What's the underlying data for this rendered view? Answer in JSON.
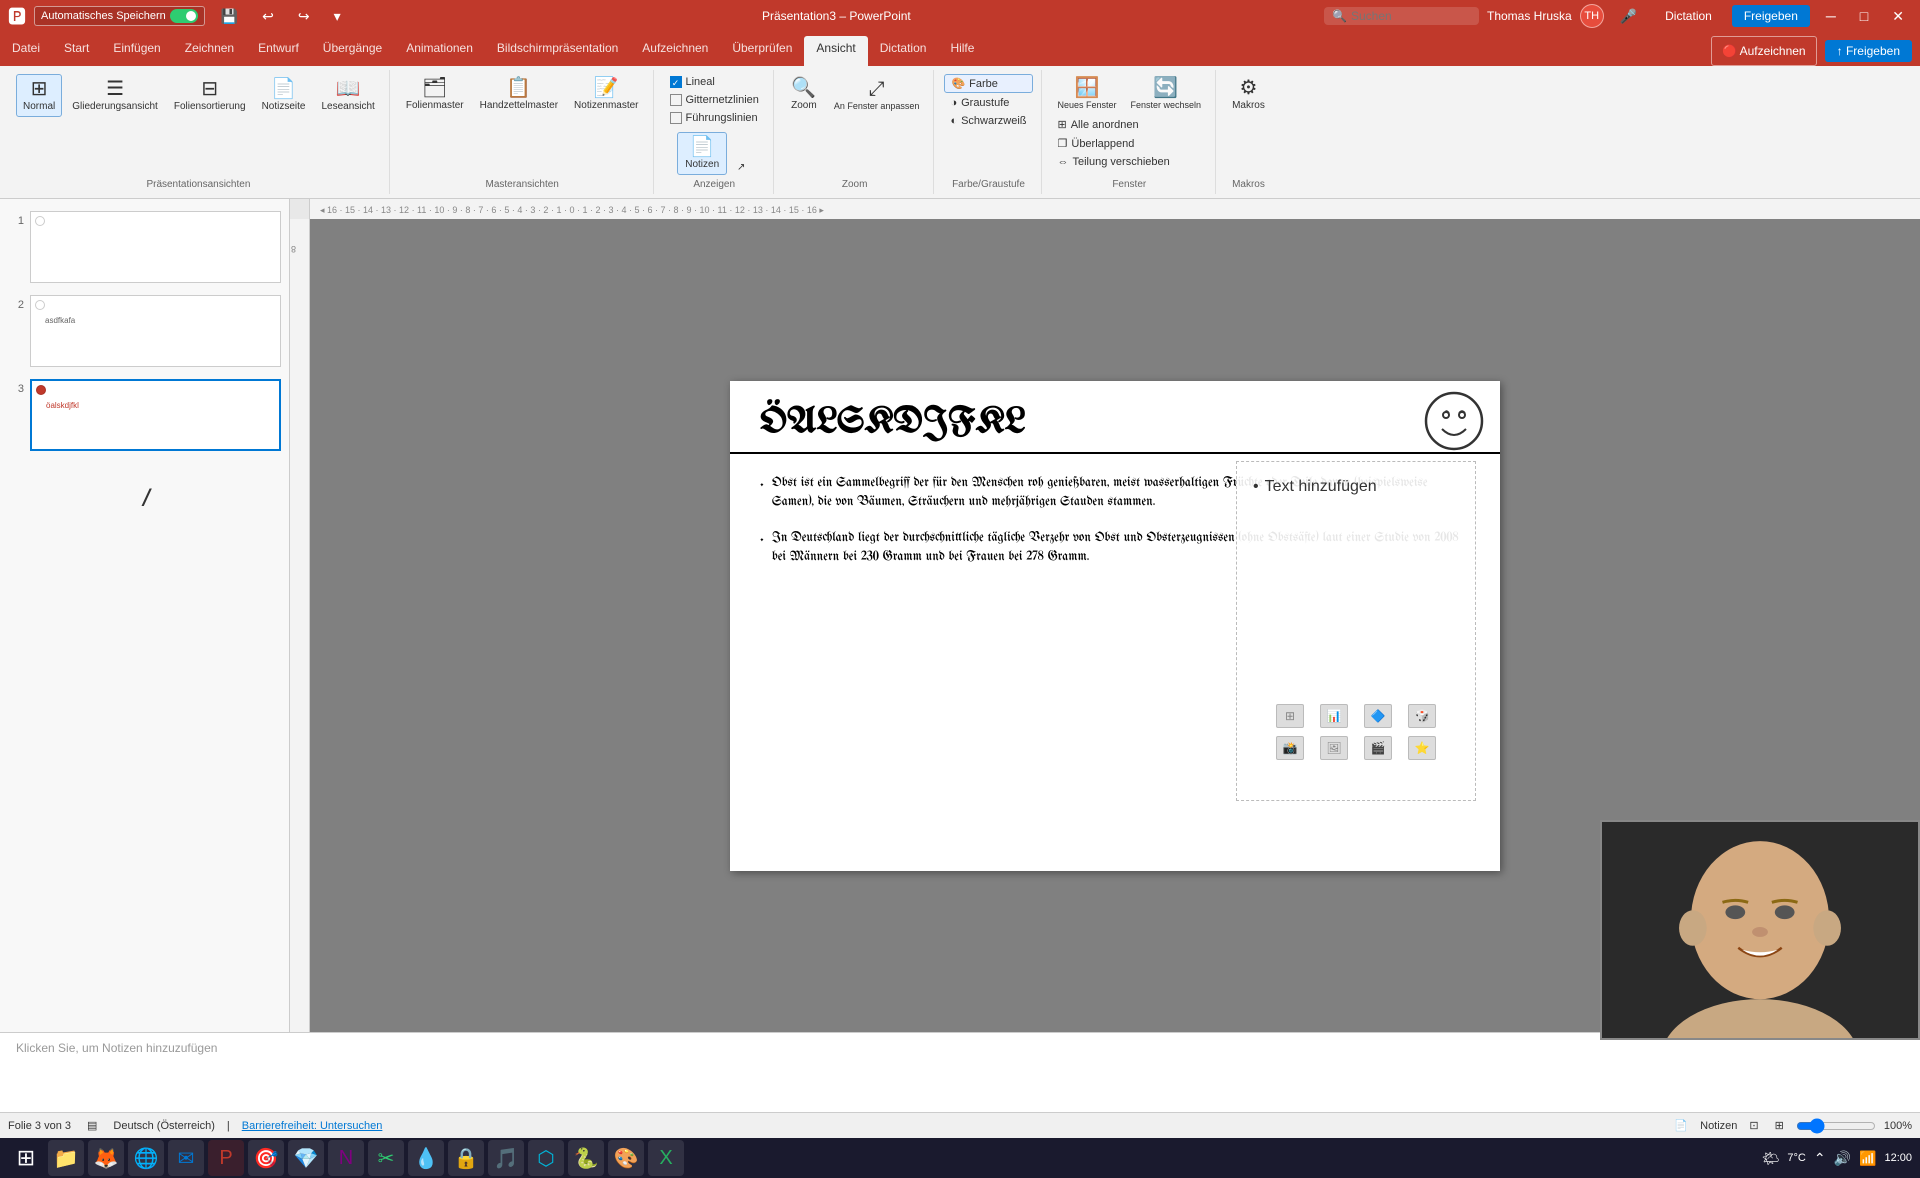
{
  "titleBar": {
    "autosave": "Automatisches Speichern",
    "filename": "Präsentation3",
    "app": "PowerPoint",
    "searchPlaceholder": "Suchen",
    "username": "Thomas Hruska",
    "initials": "TH",
    "windowControls": [
      "─",
      "□",
      "✕"
    ]
  },
  "ribbon": {
    "tabs": [
      "Datei",
      "Start",
      "Einfügen",
      "Zeichnen",
      "Entwurf",
      "Übergänge",
      "Animationen",
      "Bildschirmpräsentation",
      "Aufzeichnen",
      "Überprüfen",
      "Ansicht",
      "Dictation",
      "Hilfe"
    ],
    "activeTab": "Ansicht",
    "groups": {
      "prasentationsansichten": {
        "label": "Präsentationsansichten",
        "items": [
          "Normal",
          "Gliederungsansicht",
          "Foliensortierung",
          "Notizseite",
          "Leseansicht"
        ]
      },
      "masteransichten": {
        "label": "Masteransichten",
        "items": [
          "Folienmaster",
          "Handzettelmaster",
          "Notizenmaster"
        ]
      },
      "anzeigen": {
        "label": "Anzeigen",
        "checkboxes": [
          "Lineal",
          "Gitternetzlinien",
          "Führungslinien"
        ],
        "notizen": "Notizen"
      },
      "zoom": {
        "label": "Zoom",
        "zoom": "Zoom",
        "anFenster": "An Fenster\nanpassen"
      },
      "farbe": {
        "label": "Farbe/Graustufe",
        "items": [
          "Farbe",
          "Graustufe",
          "Schwarzweiß"
        ]
      },
      "fenster": {
        "label": "Fenster",
        "items": [
          "Alle anordnen",
          "Überlappend",
          "Teilung verschieben",
          "Neues Fenster",
          "Fenster wechseln"
        ]
      },
      "makros": {
        "label": "Makros",
        "items": [
          "Makros"
        ]
      }
    }
  },
  "slides": [
    {
      "num": "1",
      "active": false,
      "dotColor": "white"
    },
    {
      "num": "2",
      "active": false,
      "dotColor": "white",
      "label": "asdfkafa"
    },
    {
      "num": "3",
      "active": true,
      "dotColor": "red",
      "label": "öalskdjfkl"
    }
  ],
  "slide": {
    "title": "ÖALSKDJFKL",
    "bullets": [
      "Obst ist ein Sammelbegriff der für den Menschen roh genießbaren, meist wasserhaltigen Früchte oder Teile davon (beispielsweise Samen), die von Bäumen, Sträuchern und mehrjährigen Stauden stammen.",
      "In Deutschland liegt der durchschnittliche tägliche Verzehr von Obst und Obsterzeugnissen (ohne Obstsäfte) laut einer Studie von 2008 bei Männern bei 230 Gramm und bei Frauen bei 278 Gramm."
    ],
    "placeholderText": "Text hinzufügen"
  },
  "statusBar": {
    "slideInfo": "Folie 3 von 3",
    "language": "Deutsch (Österreich)",
    "accessibility": "Barrierefreiheit: Untersuchen",
    "notizen": "Notizen"
  },
  "notesPlaceholder": "Klicken Sie, um Notizen hinzuzufügen",
  "taskbar": {
    "time": "7°C",
    "icons": [
      "⊞",
      "📁",
      "🦊",
      "🌐",
      "📧",
      "📊",
      "🎯",
      "💎",
      "📘",
      "✂",
      "🔵",
      "🔒",
      "🎵",
      "💻",
      "🐍",
      "🐻",
      "📱",
      "💛"
    ]
  },
  "dictationTab": "Dictation",
  "aufzeichnen": "Aufzeichnen",
  "freigeben": "Freigeben"
}
